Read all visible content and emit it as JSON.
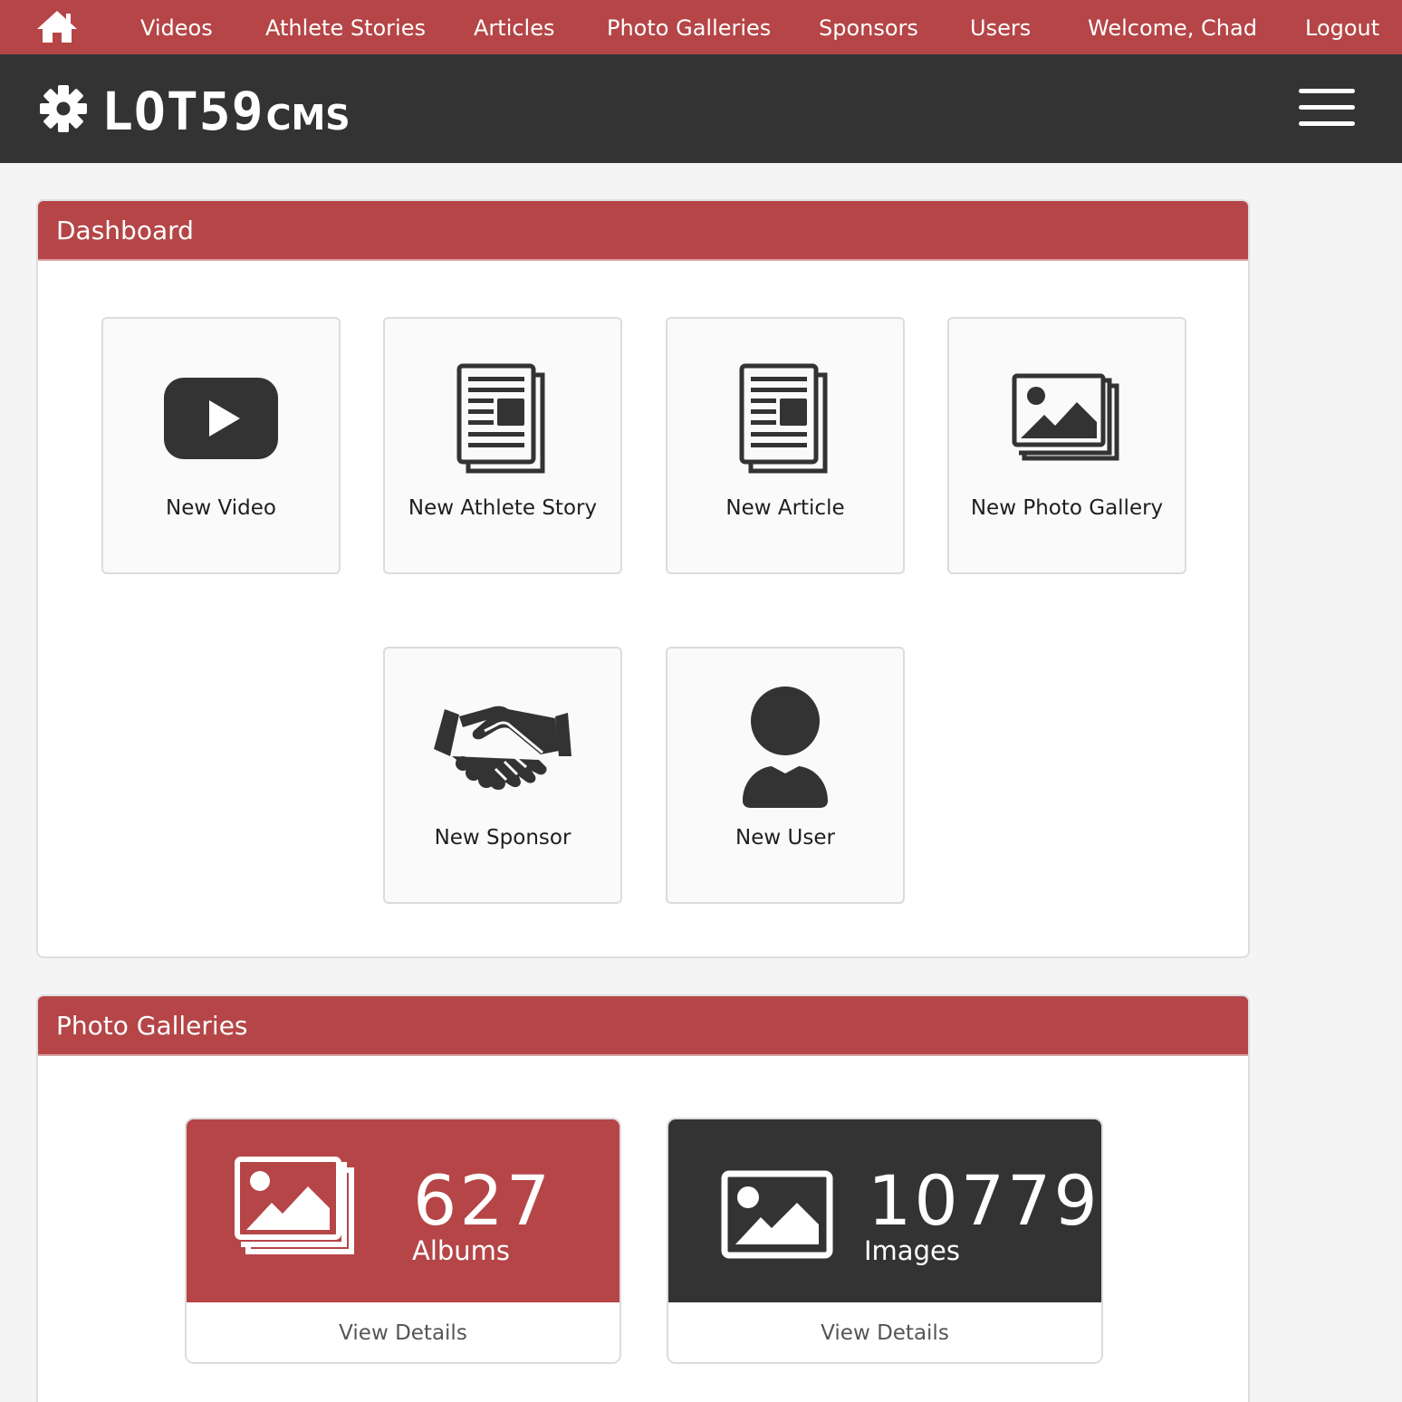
{
  "nav": {
    "links": [
      "Videos",
      "Athlete Stories",
      "Articles",
      "Photo Galleries",
      "Sponsors",
      "Users",
      "Welcome, Chad",
      "Logout"
    ],
    "icon": "home-icon"
  },
  "brand": {
    "name": "LOT59",
    "suffix": "CMS"
  },
  "dashboard": {
    "title": "Dashboard",
    "tiles": [
      {
        "label": "New Video",
        "icon": "youtube-play-icon"
      },
      {
        "label": "New Athlete Story",
        "icon": "newspaper-icon"
      },
      {
        "label": "New Article",
        "icon": "newspaper-icon"
      },
      {
        "label": "New Photo Gallery",
        "icon": "images-icon"
      },
      {
        "label": "New Sponsor",
        "icon": "handshake-icon"
      },
      {
        "label": "New User",
        "icon": "user-icon"
      }
    ]
  },
  "galleries": {
    "title": "Photo Galleries",
    "stats": [
      {
        "value": "627",
        "caption": "Albums",
        "link": "View Details",
        "color": "#b54547",
        "icon": "images-icon"
      },
      {
        "value": "10779",
        "caption": "Images",
        "link": "View Details",
        "color": "#333333",
        "icon": "image-icon"
      }
    ]
  },
  "colors": {
    "accent": "#b54547",
    "dark": "#333333",
    "background": "#f4f4f4"
  }
}
